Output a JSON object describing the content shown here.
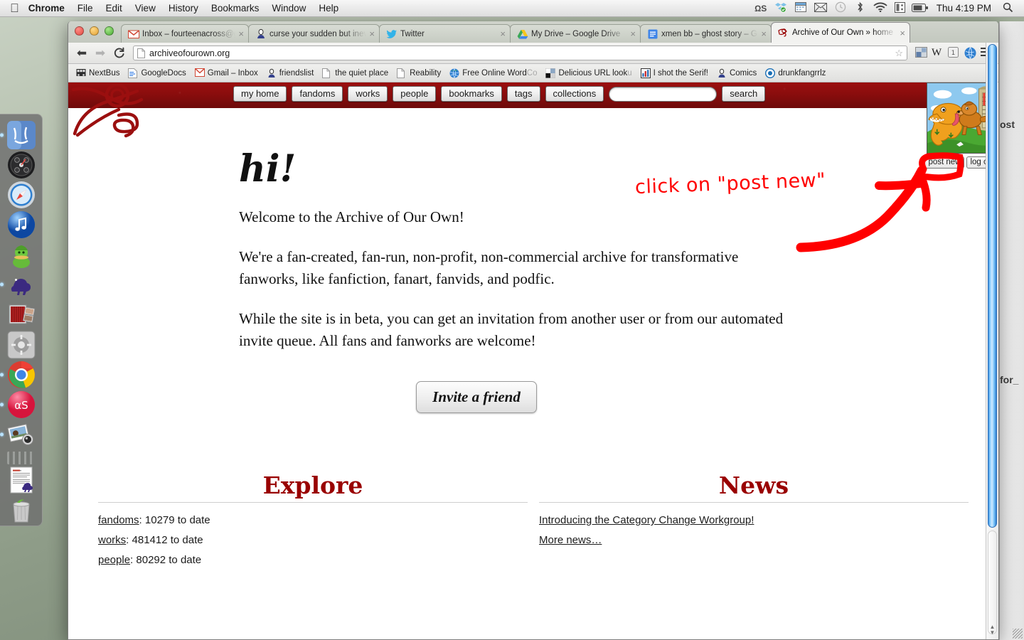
{
  "menubar": {
    "apple": "apple-logo",
    "items": [
      {
        "label": "Chrome",
        "bold": true
      },
      {
        "label": "File",
        "bold": false
      },
      {
        "label": "Edit",
        "bold": false
      },
      {
        "label": "View",
        "bold": false
      },
      {
        "label": "History",
        "bold": false
      },
      {
        "label": "Bookmarks",
        "bold": false
      },
      {
        "label": "Window",
        "bold": false
      },
      {
        "label": "Help",
        "bold": false
      }
    ],
    "status_icons": [
      "lastfm-icon",
      "dropbox-icon",
      "calendar-icon",
      "mail-icon",
      "timemachine-icon",
      "bluetooth-icon",
      "wifi-icon",
      "app-icon",
      "battery-icon"
    ],
    "clock": "Thu 4:19 PM",
    "search_icon": "spotlight-search-icon"
  },
  "dock": {
    "items": [
      {
        "name": "finder",
        "running": true
      },
      {
        "name": "dashboard",
        "running": false
      },
      {
        "name": "safari",
        "running": false
      },
      {
        "name": "itunes",
        "running": false
      },
      {
        "name": "green-creature-app",
        "running": false
      },
      {
        "name": "dinosaur-app",
        "running": true
      },
      {
        "name": "photo-booth",
        "running": false
      },
      {
        "name": "system-preferences",
        "running": false
      },
      {
        "name": "google-chrome",
        "running": true
      },
      {
        "name": "lastfm",
        "running": true
      },
      {
        "name": "iphoto",
        "running": true
      },
      {
        "name": "separator",
        "running": false
      },
      {
        "name": "document-dinosaur",
        "running": false
      },
      {
        "name": "trash",
        "running": false
      }
    ]
  },
  "browser": {
    "tabs": [
      {
        "title": "Inbox – fourteenacross@gm",
        "favicon": "gmail-icon",
        "active": false,
        "truncated": true
      },
      {
        "title": "curse your sudden but inevi",
        "favicon": "lj-user-icon",
        "active": false,
        "truncated": true
      },
      {
        "title": "Twitter",
        "favicon": "twitter-icon",
        "active": false,
        "truncated": false
      },
      {
        "title": "My Drive – Google Drive",
        "favicon": "google-drive-icon",
        "active": false,
        "truncated": false
      },
      {
        "title": "xmen bb – ghost story – Go",
        "favicon": "google-docs-icon",
        "active": false,
        "truncated": true
      },
      {
        "title": "Archive of Our Own » home",
        "favicon": "ao3-icon",
        "active": true,
        "truncated": false
      }
    ],
    "nav": {
      "back": "◀",
      "forward": "▶",
      "reload": "C"
    },
    "address": {
      "url": "archiveofourown.org",
      "page_icon": "page-icon",
      "star_icon": "bookmark-star-icon"
    },
    "toolbar_right": [
      "extension-icon",
      "wikipedia-icon",
      "extension-1-icon",
      "globe-icon",
      "chrome-menu-icon"
    ],
    "bookmarks": [
      {
        "label": "NextBus",
        "icon": "bus-icon",
        "fade": ""
      },
      {
        "label": "GoogleDocs",
        "icon": "docs-icon",
        "fade": ""
      },
      {
        "label": "Gmail – Inbox",
        "icon": "gmail-icon",
        "fade": ""
      },
      {
        "label": "friendslist",
        "icon": "lj-user-icon",
        "fade": ""
      },
      {
        "label": "the quiet place",
        "icon": "page-icon",
        "fade": ""
      },
      {
        "label": "Reability",
        "icon": "page-icon",
        "fade": ""
      },
      {
        "label": "Free Online Word ",
        "icon": "globe-icon",
        "fade": "Co"
      },
      {
        "label": "Delicious URL look ",
        "icon": "delicious-icon",
        "fade": "u"
      },
      {
        "label": "I shot the Serif!",
        "icon": "chart-icon",
        "fade": ""
      },
      {
        "label": "Comics",
        "icon": "lj-user-icon",
        "fade": ""
      },
      {
        "label": "drunkfangrrlz",
        "icon": "lj-community-icon",
        "fade": ""
      }
    ]
  },
  "ao3": {
    "logo": "ao3-logo",
    "nav_buttons": [
      "my home",
      "fandoms",
      "works",
      "people",
      "bookmarks",
      "tags",
      "collections"
    ],
    "search_placeholder": "",
    "search_value": "",
    "search_button": "search",
    "avatar": "user-avatar-dinosaur-and-dog",
    "user_buttons": [
      "post new",
      "log out"
    ],
    "heading": "hi!",
    "paragraphs": [
      "Welcome to the Archive of Our Own!",
      "We're a fan-created, fan-run, non-profit, non-commercial archive for transformative fanworks, like fanfiction, fanart, fanvids, and podfic.",
      "While the site is in beta, you can get an invitation from another user or from our automated invite queue. All fans and fanworks are welcome!"
    ],
    "invite_button": "Invite a friend",
    "explore": {
      "heading": "Explore",
      "items": [
        {
          "link": "fandoms",
          "rest": ": 10279 to date"
        },
        {
          "link": "works",
          "rest": ": 481412 to date"
        },
        {
          "link": "people",
          "rest": ": 80292 to date"
        }
      ]
    },
    "news": {
      "heading": "News",
      "items": [
        {
          "link": "Introducing the Category Change Workgroup!",
          "rest": ""
        },
        {
          "link": "More news…",
          "rest": ""
        }
      ]
    }
  },
  "annotation": {
    "text": "click on \"post new\"",
    "color": "#ff0000",
    "target": "post-new-button"
  },
  "background_window": {
    "fragments": [
      "ost",
      "for_"
    ]
  }
}
